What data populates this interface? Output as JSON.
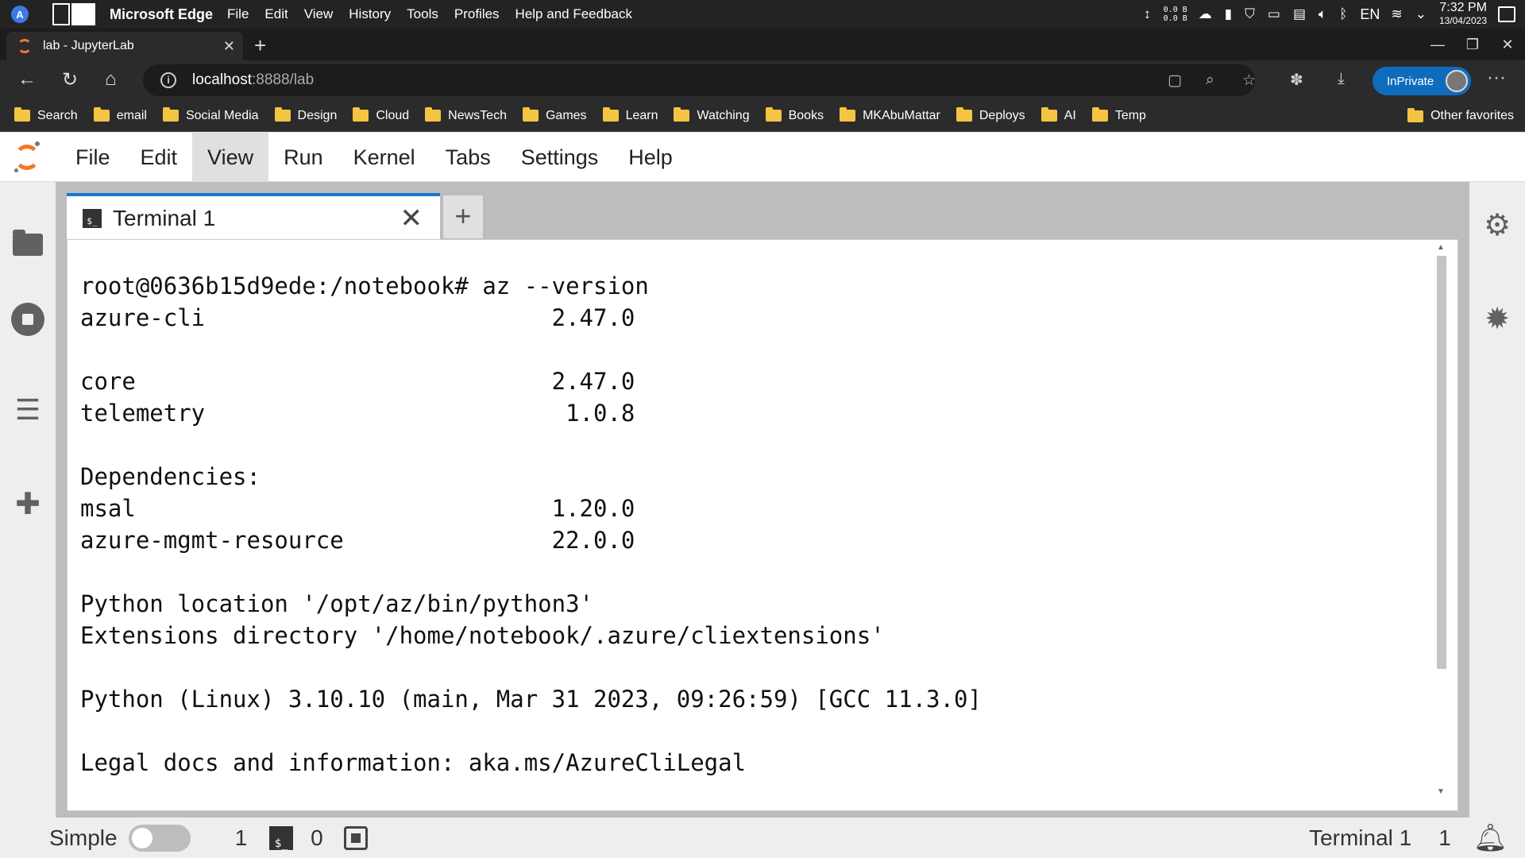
{
  "system": {
    "logo_letter": "A",
    "app_name": "Microsoft Edge",
    "menu": [
      "File",
      "Edit",
      "View",
      "History",
      "Tools",
      "Profiles",
      "Help and Feedback"
    ],
    "net_up": "0.0 B",
    "net_down": "0.0 B",
    "lang": "EN",
    "time": "7:32 PM",
    "date": "13/04/2023"
  },
  "browser": {
    "tab_title": "lab - JupyterLab",
    "url_host": "localhost",
    "url_rest": ":8888/lab",
    "inprivate_label": "InPrivate",
    "favorites": [
      "Search",
      "email",
      "Social Media",
      "Design",
      "Cloud",
      "NewsTech",
      "Games",
      "Learn",
      "Watching",
      "Books",
      "MKAbuMattar",
      "Deploys",
      "AI",
      "Temp"
    ],
    "other_favorites": "Other favorites"
  },
  "jupyter": {
    "menu": [
      "File",
      "Edit",
      "View",
      "Run",
      "Kernel",
      "Tabs",
      "Settings",
      "Help"
    ],
    "active_menu": "View",
    "tab_title": "Terminal 1",
    "term_icon_text": "$_",
    "terminal_lines": [
      "root@0636b15d9ede:/notebook# az --version",
      "azure-cli                         2.47.0",
      "",
      "core                              2.47.0",
      "telemetry                          1.0.8",
      "",
      "Dependencies:",
      "msal                              1.20.0",
      "azure-mgmt-resource               22.0.0",
      "",
      "Python location '/opt/az/bin/python3'",
      "Extensions directory '/home/notebook/.azure/cliextensions'",
      "",
      "Python (Linux) 3.10.10 (main, Mar 31 2023, 09:26:59) [GCC 11.3.0]",
      "",
      "Legal docs and information: aka.ms/AzureCliLegal"
    ]
  },
  "statusbar": {
    "simple_label": "Simple",
    "terminals_count": "1",
    "kernels_count": "0",
    "active_label": "Terminal 1",
    "notifications_count": "1"
  },
  "colors": {
    "jupyter_orange": "#f37726",
    "tab_accent": "#1976d2",
    "inprivate_blue": "#0f6cbd"
  }
}
